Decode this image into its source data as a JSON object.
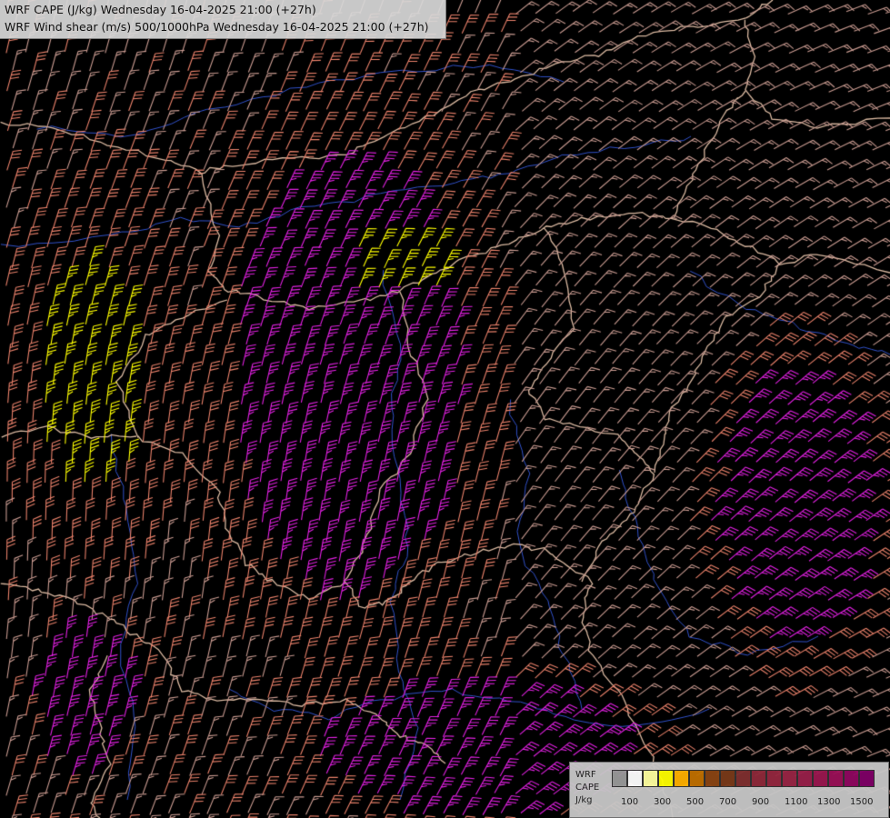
{
  "title": {
    "line1": "WRF CAPE (J/kg) Wednesday 16-04-2025 21:00 (+27h)",
    "line2": "WRF Wind shear (m/s) 500/1000hPa Wednesday 16-04-2025 21:00 (+27h)"
  },
  "legend": {
    "title_lines": [
      "WRF",
      "CAPE",
      "J/kg"
    ],
    "colors": [
      "#9a9a9a",
      "#ffffff",
      "#ffffa0",
      "#ffff00",
      "#ffb000",
      "#c07000",
      "#8b4513",
      "#7a3a1a",
      "#803030",
      "#8f2a3a",
      "#952840",
      "#982545",
      "#99204a",
      "#9a1850",
      "#9a1058",
      "#900860",
      "#800068"
    ],
    "tick_labels": [
      "100",
      "300",
      "500",
      "700",
      "900",
      "1100",
      "1300",
      "1500"
    ]
  },
  "map_colors": {
    "background": "#000000",
    "borders": "#d9b8a0",
    "rivers": "#3050c8",
    "barb_low": "#c89a90",
    "barb_mid": "#e8806a",
    "barb_high": "#e020e0",
    "barb_cape": "#ffff00"
  }
}
